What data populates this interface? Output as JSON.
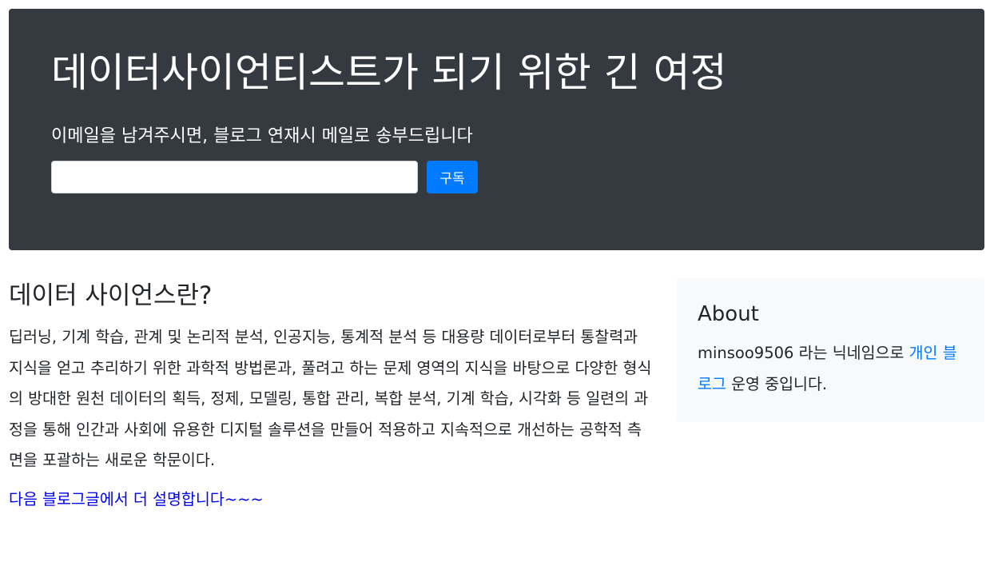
{
  "header": {
    "title": "데이터사이언티스트가 되기 위한 긴 여정",
    "lead": "이메일을 남겨주시면, 블로그 연재시 메일로 송부드립니다",
    "email_value": "",
    "subscribe_label": "구독"
  },
  "main": {
    "heading": "데이터 사이언스란?",
    "body": "딥러닝, 기계 학습, 관계 및 논리적 분석, 인공지능, 통계적 분석 등 대용량 데이터로부터 통찰력과 지식을 얻고 추리하기 위한 과학적 방법론과, 풀려고 하는 문제 영역의 지식을 바탕으로 다양한 형식의 방대한 원천 데이터의 획득, 정제, 모델링, 통합 관리, 복합 분석, 기계 학습, 시각화 등 일련의 과정을 통해 인간과 사회에 유용한 디지털 솔루션을 만들어 적용하고 지속적으로 개선하는 공학적 측면을 포괄하는 새로운 학문이다.",
    "more_link": "다음 블로그글에서 더 설명합니다~~~"
  },
  "sidebar": {
    "title": "About",
    "text_before": "minsoo9506 라는 닉네임으로 ",
    "link_label": "개인 블로그",
    "text_after": " 운영 중입니다."
  },
  "colors": {
    "jumbotron_bg": "#343a40",
    "primary": "#007bff",
    "sidebar_bg": "#f8f9fa"
  }
}
